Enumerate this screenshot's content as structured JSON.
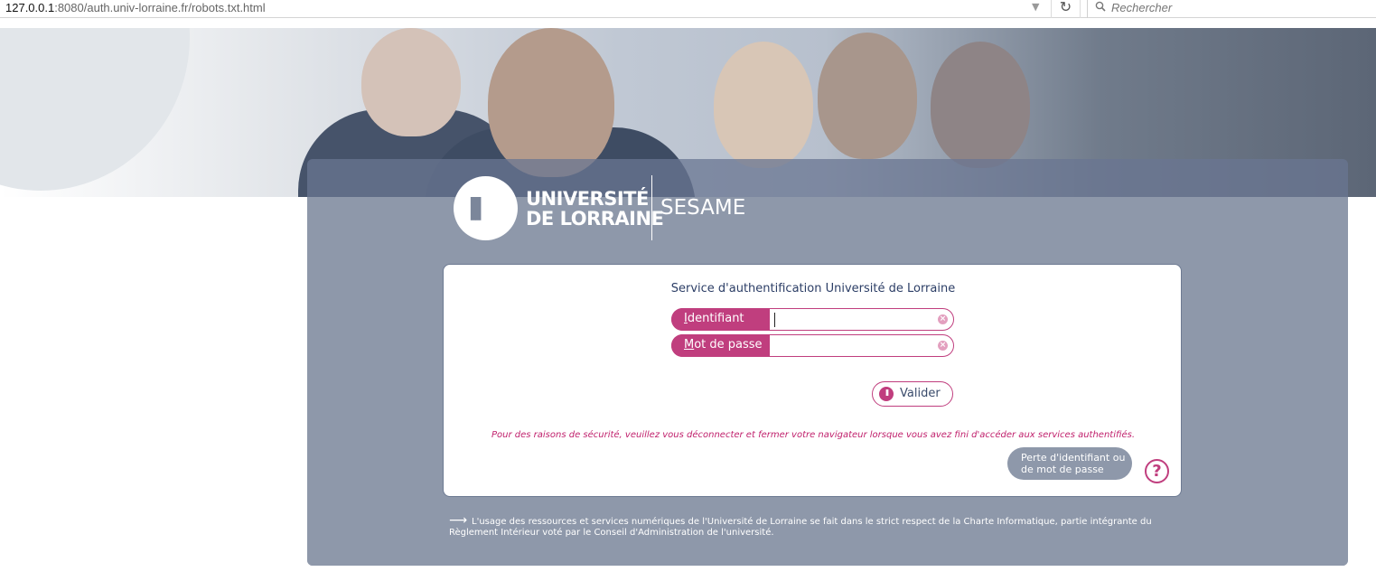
{
  "browser": {
    "url_host": "127.0.0.1",
    "url_rest": ":8080/auth.univ-lorraine.fr/robots.txt.html",
    "search_placeholder": "Rechercher"
  },
  "header": {
    "university_line1": "UNIVERSITÉ",
    "university_line2": "DE LORRAINE",
    "app_name": "SESAME"
  },
  "login": {
    "title": "Service d'authentification Université de Lorraine",
    "username_label_key": "I",
    "username_label_rest": "dentifiant",
    "username_value": "",
    "password_label_key": "M",
    "password_label_rest": "ot de passe",
    "password_value": "",
    "submit_label": "Valider",
    "warning": "Pour des raisons de sécurité, veuillez vous déconnecter et fermer votre navigateur lorsque vous avez fini d'accéder aux services authentifiés.",
    "help_line1": "Perte d'identifiant ou",
    "help_line2": "de mot de passe"
  },
  "footer": {
    "arrow": "⟶",
    "text": "L'usage des ressources et services numériques de l'Université de Lorraine se fait dans le strict respect de la Charte Informatique, partie intégrante du Règlement Intérieur voté par le Conseil d'Administration de l'université."
  },
  "colors": {
    "accent": "#c03e7e",
    "panel": "#8e98aa",
    "title": "#2c3e66"
  }
}
